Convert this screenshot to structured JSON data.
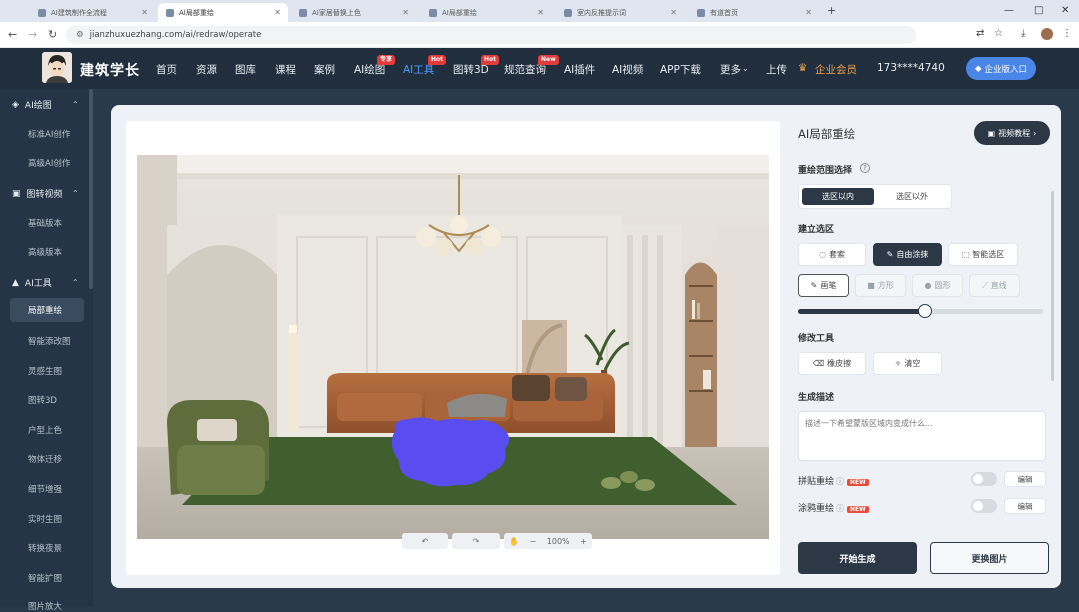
{
  "browser": {
    "tabs": [
      {
        "label": "AI建筑制作全流程",
        "active": false
      },
      {
        "label": "AI局部重绘",
        "active": true
      },
      {
        "label": "AI家居替换上色",
        "active": false
      },
      {
        "label": "AI局部重绘",
        "active": false
      },
      {
        "label": "室内反推提示词",
        "active": false
      },
      {
        "label": "有道首页",
        "active": false
      }
    ],
    "new_tab": "+",
    "url": "jianzhuxuezhang.com/ai/redraw/operate",
    "window_controls": [
      "—",
      "□",
      "✕"
    ]
  },
  "header": {
    "brand": "建筑学长",
    "nav": [
      {
        "label": "首页"
      },
      {
        "label": "资源"
      },
      {
        "label": "图库"
      },
      {
        "label": "课程"
      },
      {
        "label": "案例"
      },
      {
        "label": "AI绘图",
        "badge": "专享"
      },
      {
        "label": "AI工具",
        "badge": "Hot",
        "active": true
      },
      {
        "label": "图转3D",
        "badge": "Hot"
      },
      {
        "label": "规范查询",
        "badge": "New"
      },
      {
        "label": "AI插件"
      },
      {
        "label": "AI视频"
      },
      {
        "label": "APP下载"
      },
      {
        "label": "更多"
      },
      {
        "label": "上传"
      }
    ],
    "vip": "企业会员",
    "user": "173****4740",
    "enterprise_button": "企业版入口"
  },
  "sidebar": {
    "groups": [
      {
        "title": "AI绘图",
        "items": [
          "标准AI创作",
          "高级AI创作"
        ]
      },
      {
        "title": "图转视频",
        "items": [
          "基础版本",
          "高级版本"
        ]
      },
      {
        "title": "AI工具",
        "items": [
          "局部重绘",
          "智能添改图",
          "灵感生图",
          "图转3D",
          "户型上色",
          "物体迁移",
          "细节增强",
          "实时生图",
          "转换夜景",
          "智能扩图",
          "图片放大"
        ]
      }
    ],
    "active_item": "局部重绘"
  },
  "editor": {
    "zoom": "100%"
  },
  "panel": {
    "title": "AI局部重绘",
    "tutorial_button": "视频教程",
    "scope_label": "重绘范围选择",
    "scope_options": [
      "选区以内",
      "选区以外"
    ],
    "scope_selected": "选区以内",
    "selection_label": "建立选区",
    "selection_modes": [
      "套索",
      "自由涂抹",
      "智能选区"
    ],
    "selection_selected": "自由涂抹",
    "brush_tools": [
      "画笔",
      "方形",
      "圆形",
      "直线"
    ],
    "brush_size_fraction": 0.52,
    "modify_label": "修改工具",
    "modify_tools": [
      "橡皮擦",
      "清空"
    ],
    "prompt_label": "生成描述",
    "prompt_placeholder": "描述一下希望蒙版区域内变成什么...",
    "options": [
      {
        "label": "拼贴重绘",
        "tag": "NEW",
        "button": "编辑"
      },
      {
        "label": "涂鸦重绘",
        "tag": "NEW",
        "button": "编辑"
      }
    ],
    "generate_button": "开始生成",
    "replace_button": "更换图片"
  },
  "colors": {
    "accent": "#4a86e8",
    "mask": "#5a4df0",
    "header_bg": "#202e3e",
    "sofa": "#a9653a"
  }
}
